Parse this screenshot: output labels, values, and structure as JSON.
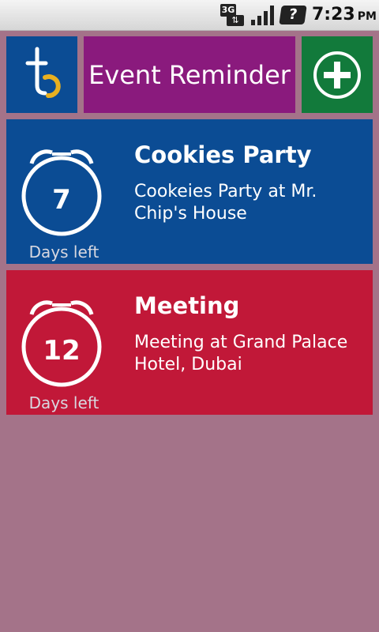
{
  "status_bar": {
    "network_type": "3G",
    "time": "7:23",
    "ampm": "PM",
    "icons": [
      "network-3g-icon",
      "signal-icon",
      "notification-question-icon"
    ]
  },
  "header": {
    "app_title": "Event Reminder",
    "logo_icon": "app-logo-icon",
    "add_icon": "add-circle-icon",
    "colors": {
      "logo_bg": "#0b4c94",
      "title_bg": "#8a1a7d",
      "add_bg": "#127a3b"
    }
  },
  "events": [
    {
      "days": "7",
      "days_label": "Days left",
      "title": "Cookies Party",
      "description": "Cookeies Party at Mr. Chip's House",
      "color": "#0b4c94"
    },
    {
      "days": "12",
      "days_label": "Days left",
      "title": "Meeting",
      "description": "Meeting at Grand Palace Hotel, Dubai",
      "color": "#c11838"
    }
  ],
  "page_background": "#a47389"
}
